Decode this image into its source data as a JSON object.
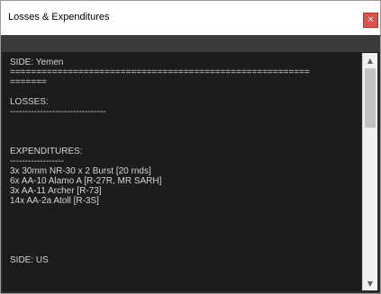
{
  "window": {
    "title": "Losses & Expenditures",
    "close_glyph": "×"
  },
  "report": {
    "lines": [
      "SIDE: Yemen",
      "=========================================================",
      "=======",
      "",
      "LOSSES:",
      "--------------------------------",
      "",
      "",
      "",
      "EXPENDITURES:",
      "------------------",
      "3x 30mm NR-30 x 2 Burst [20 rnds]",
      "6x AA-10 Alamo A [R-27R, MR SARH]",
      "3x AA-11 Archer [R-73]",
      "14x AA-2a Atoll [R-3S]",
      "",
      "",
      "",
      "",
      "",
      "SIDE: US"
    ]
  },
  "scrollbar": {
    "up_glyph": "▲",
    "down_glyph": "▼"
  },
  "colors": {
    "background": "#1c1c1c",
    "text": "#d4d4d4",
    "close_button": "#d9534f"
  }
}
